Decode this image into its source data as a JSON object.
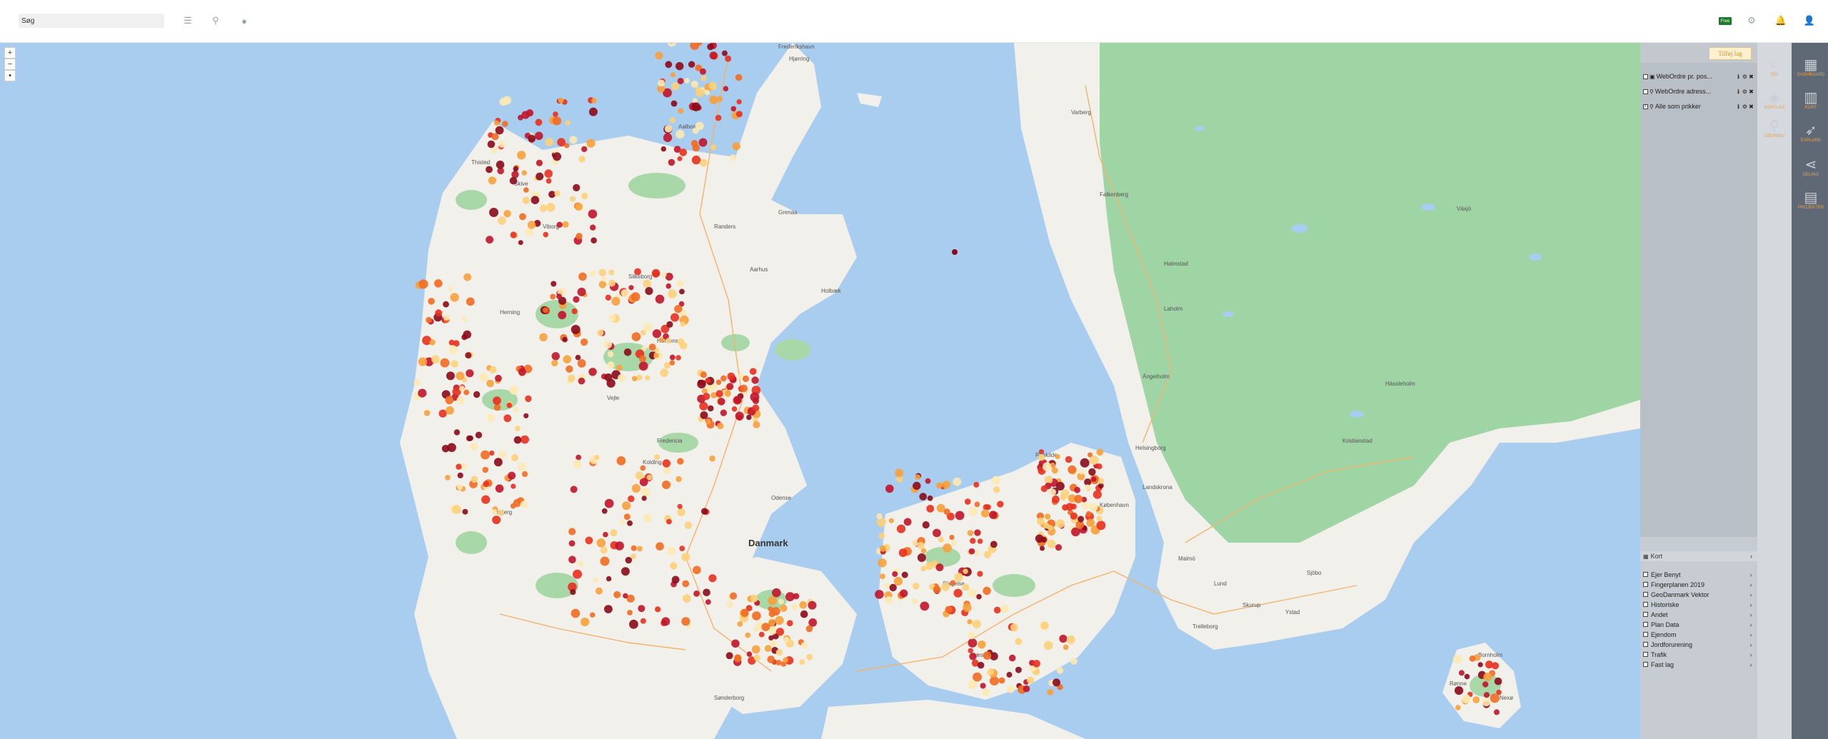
{
  "search": {
    "value": "Søg"
  },
  "topbar": {
    "free_badge": "Free"
  },
  "map": {
    "country_label": "Danmark",
    "place_labels": [
      "Frederikshavn",
      "Hjørring",
      "Aalborg",
      "Randers",
      "Aarhus",
      "Vejle",
      "Esbjerg",
      "Odense",
      "Roskilde",
      "København",
      "Halmstad",
      "Helsingborg",
      "Malmö",
      "Lund",
      "Kristianstad",
      "Växjö",
      "Ystad",
      "Trelleborg",
      "Ängelholm",
      "Landskrona",
      "Silkeborg",
      "Viborg",
      "Herning",
      "Kolding",
      "Fredericia",
      "Holbæk",
      "Slagelse",
      "Næstved",
      "Sønderborg",
      "Bornholm",
      "Rønne",
      "Nexø",
      "Skive",
      "Thisted",
      "Horsens",
      "Grenaa",
      "Varberg",
      "Falkenberg",
      "Laholm",
      "Hässleholm",
      "Skurup",
      "Sjöbo"
    ],
    "dot_colors": [
      "#8b0a1a",
      "#c0142a",
      "#e8301f",
      "#f26b21",
      "#f8a03c",
      "#fcd07a",
      "#fde9b2"
    ]
  },
  "panel": {
    "add_layer_button": "Tilføj lag",
    "layers": [
      {
        "name": "WebOrdre pr. pos..."
      },
      {
        "name": "WebOrdre adress..."
      },
      {
        "name": "Alle som prikker"
      }
    ],
    "kort_header": "Kort",
    "kort_items": [
      "Ejer Benyt",
      "Fingerplanen 2019",
      "GeoDanmark Vektor",
      "Historiske",
      "Andet",
      "Plan Data",
      "Ejendom",
      "Jordforurening",
      "Trafik",
      "Fast lag"
    ]
  },
  "sidebar": {
    "items": [
      "POI",
      "KORTLAG",
      "DASHBOARD",
      "KORT",
      "SØGNING",
      "EXPLORE",
      "DELING",
      "PROJEKTER"
    ]
  }
}
